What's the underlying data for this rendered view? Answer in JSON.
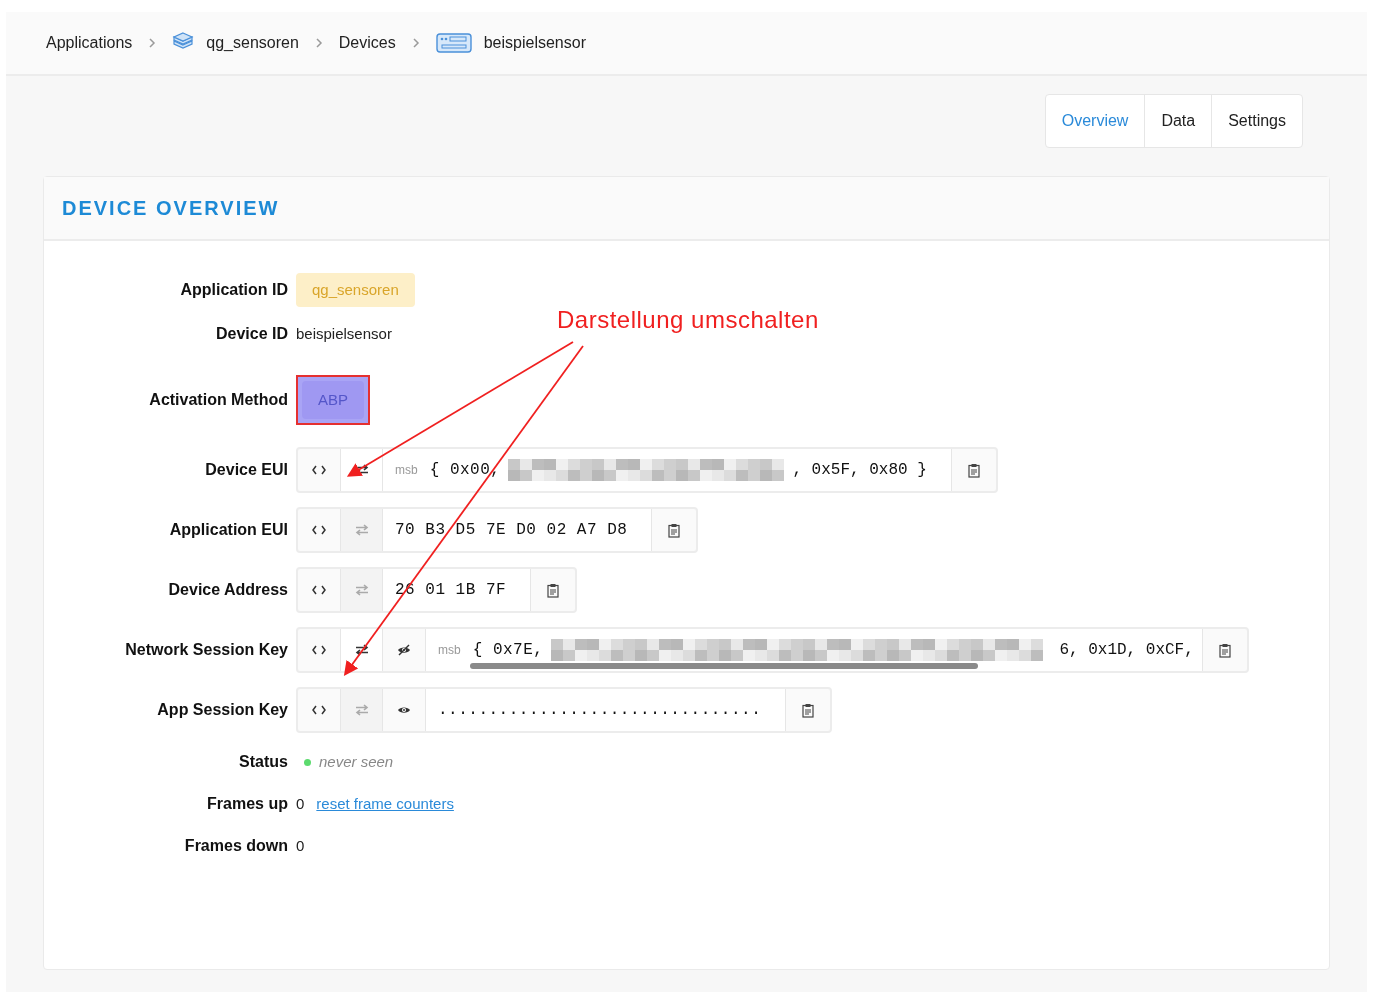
{
  "breadcrumbs": [
    {
      "label": "Applications",
      "kind": "plain"
    },
    {
      "label": "qg_sensoren",
      "kind": "application"
    },
    {
      "label": "Devices",
      "kind": "plain"
    },
    {
      "label": "beispielsensor",
      "kind": "device"
    }
  ],
  "tabs": [
    {
      "label": "Overview",
      "selected": true
    },
    {
      "label": "Data",
      "selected": false
    },
    {
      "label": "Settings",
      "selected": false
    }
  ],
  "card": {
    "title": "DEVICE OVERVIEW"
  },
  "rows": [
    {
      "label": "Application ID",
      "kind": "badge",
      "value": "qg_sensoren"
    },
    {
      "label": "Device ID",
      "kind": "text",
      "value": "beispielsensor"
    },
    {
      "label": "Activation Method",
      "kind": "method",
      "value": "ABP",
      "highlighted": true
    },
    {
      "label": "Device EUI",
      "kind": "bytes",
      "swap_enabled": true,
      "prefix": "msb",
      "before": "{ 0x00,",
      "redacted": true,
      "after": ", 0x5F, 0x80 }",
      "scrollable": false
    },
    {
      "label": "Application EUI",
      "kind": "bytes",
      "swap_enabled": false,
      "before": "70 B3 D5 7E D0 02 A7 D8",
      "redacted": false,
      "scrollable": false
    },
    {
      "label": "Device Address",
      "kind": "bytes",
      "swap_enabled": false,
      "before": "26 01 1B 7F",
      "redacted": false,
      "scrollable": false
    },
    {
      "label": "Network Session Key",
      "kind": "key",
      "swap_enabled": true,
      "revealed": true,
      "prefix": "msb",
      "before": "{ 0x7E,",
      "redacted": true,
      "after": "6, 0x1D, 0xCF,",
      "scrollable": true
    },
    {
      "label": "App Session Key",
      "kind": "key",
      "swap_enabled": false,
      "revealed": false,
      "before": "................................",
      "redacted": false,
      "scrollable": false
    },
    {
      "label": "Status",
      "kind": "status",
      "value": "never seen",
      "color": "#5cdb6e"
    },
    {
      "label": "Frames up",
      "kind": "counter",
      "value": "0",
      "link": "reset frame counters"
    },
    {
      "label": "Frames down",
      "kind": "counter",
      "value": "0"
    }
  ],
  "annotation": {
    "text": "Darstellung umschalten"
  }
}
